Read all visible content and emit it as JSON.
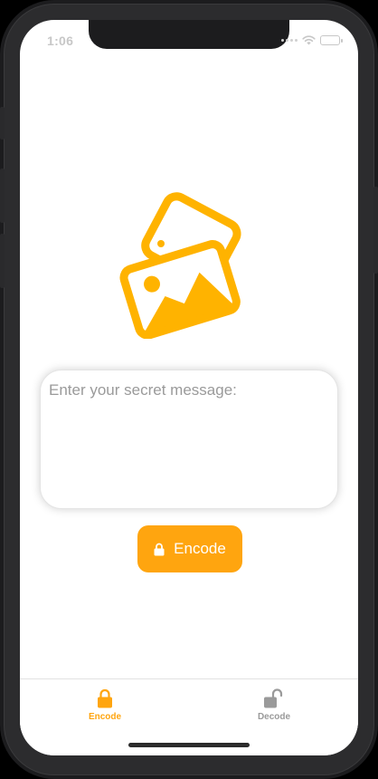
{
  "status_bar": {
    "time": "1:06"
  },
  "theme": {
    "accent": "#ffa50f",
    "inactive": "#9a9a9a"
  },
  "hero": {
    "icon": "photos-icon"
  },
  "message": {
    "placeholder": "Enter your secret message:",
    "value": ""
  },
  "encode_button": {
    "label": "Encode",
    "icon": "lock-icon"
  },
  "tab_bar": {
    "tabs": [
      {
        "label": "Encode",
        "icon": "lock-closed-icon",
        "selected": true
      },
      {
        "label": "Decode",
        "icon": "lock-open-icon",
        "selected": false
      }
    ]
  }
}
